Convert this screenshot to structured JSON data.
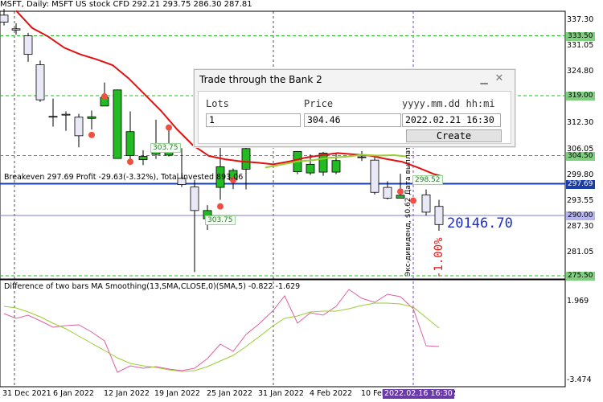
{
  "chart": {
    "symbol_line": "MSFT, Daily:  MSFT US stock CFD  292.21 293.75 286.30 287.81",
    "price_ticks": [
      "337.30",
      "331.05",
      "324.80",
      "318.55",
      "312.30",
      "306.05",
      "299.80",
      "293.55",
      "287.30",
      "281.05",
      "275.50"
    ],
    "badges": [
      {
        "text": "333.50",
        "bg": "#7ed07e",
        "fg": "#000"
      },
      {
        "text": "319.00",
        "bg": "#7ed07e",
        "fg": "#000"
      },
      {
        "text": "304.50",
        "bg": "#7ed07e",
        "fg": "#000"
      },
      {
        "text": "297.69",
        "bg": "#1a3da8",
        "fg": "#fff"
      },
      {
        "text": "290.00",
        "bg": "#b4b4ee",
        "fg": "#000"
      },
      {
        "text": "275.50",
        "bg": "#7ed07e",
        "fg": "#000"
      }
    ],
    "breakeven_text": "Breakeven 297.69 Profit -29.63(-3.32%), Total invested 893.06",
    "balance_value": "20146.70",
    "percent_value": "-1.00%",
    "vertical_note": "Экс-дивиденд, $0.62 Дата выплаты",
    "mini_labels": [
      "303.75",
      "303.75",
      "298.52"
    ],
    "dates": [
      "31 Dec 2021",
      "6 Jan 2022",
      "12 Jan 2022",
      "19 Jan 2022",
      "25 Jan 2022",
      "31 Jan 2022",
      "4 Feb 2022",
      "10 Feb",
      "22"
    ],
    "date_highlight": "2022.02.16 16:30",
    "sub_title": "Difference of two bars MA Smoothing(13,SMA,CLOSE,0)(SMA,5) -0.822 -1.629",
    "sub_ticks": [
      "1.969",
      "-3.474"
    ],
    "colors": {
      "bull": "#22bb22",
      "bear": "#e8e8f6",
      "ma": "#e21010",
      "ma2": "#9acd32",
      "osc1": "#e060a0",
      "osc2": "#9acd32",
      "grid": "#22bb22",
      "breakeven": "#1a3da8",
      "level290": "#7d7dd8"
    }
  },
  "panel": {
    "title": "Trade through the Bank 2",
    "min_icon": "minimize-icon",
    "close_icon": "close-icon",
    "lots_label": "Lots",
    "price_label": "Price",
    "date_label": "yyyy.mm.dd hh:mi",
    "lots_value": "1",
    "price_value": "304.46",
    "date_value": "2022.02.21 16:30",
    "create_label": "Create"
  }
}
